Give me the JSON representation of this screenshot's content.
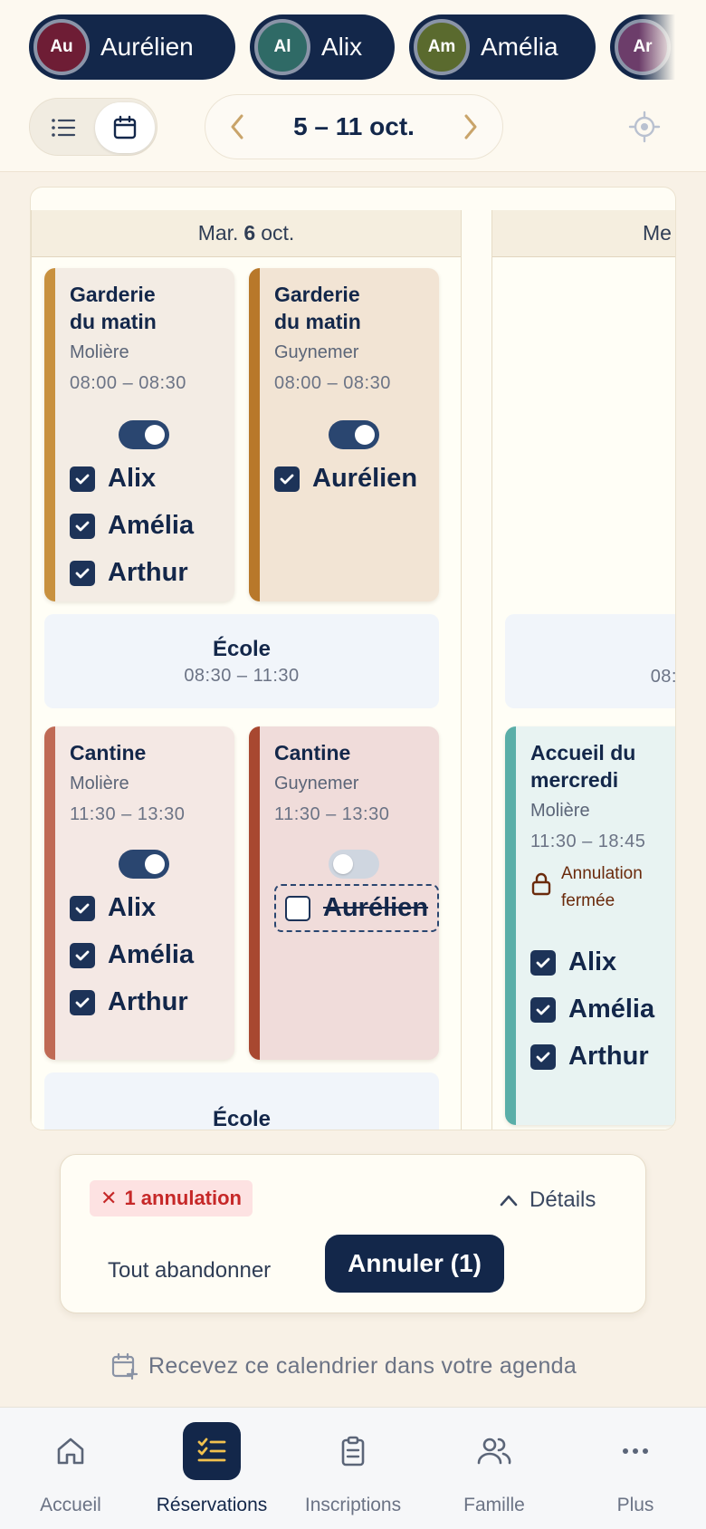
{
  "children": [
    {
      "initials": "Au",
      "name": "Aurélien",
      "color": "#6e1d35"
    },
    {
      "initials": "Al",
      "name": "Alix",
      "color": "#2f6a66"
    },
    {
      "initials": "Am",
      "name": "Amélia",
      "color": "#5a6a2e"
    },
    {
      "initials": "Ar",
      "name": "",
      "color": "#6c3d6a"
    }
  ],
  "week": {
    "label": "5 – 11 oct."
  },
  "days": [
    {
      "weekday": "Mar.",
      "daynum": "6",
      "month": "oct.",
      "morning": [
        {
          "title1": "Garderie",
          "title2": "du matin",
          "place": "Molière",
          "time": "08:00 – 08:30",
          "bar": "#c8913f",
          "bg": "#f3ece4",
          "kids": [
            "Alix",
            "Amélia",
            "Arthur"
          ]
        },
        {
          "title1": "Garderie",
          "title2": "du matin",
          "place": "Guynemer",
          "time": "08:00 – 08:30",
          "bar": "#b8782a",
          "bg": "#f2e4d4",
          "kids": [
            "Aurélien"
          ]
        }
      ],
      "school": {
        "label": "École",
        "time": "08:30 – 11:30"
      },
      "lunch": [
        {
          "title1": "Cantine",
          "place": "Molière",
          "time": "11:30 – 13:30",
          "bar": "#bf6a55",
          "bg": "#f4e8e4",
          "kids": [
            "Alix",
            "Amélia",
            "Arthur"
          ]
        },
        {
          "title1": "Cantine",
          "place": "Guynemer",
          "time": "11:30 – 13:30",
          "bar": "#a84830",
          "bg": "#f0dcda",
          "kids": [
            "Aurélien"
          ]
        }
      ],
      "school2": {
        "label": "École"
      }
    },
    {
      "weekday": "Me",
      "school": {
        "time": "08:"
      },
      "afternoon": {
        "title1": "Accueil du",
        "title2": "mercredi",
        "place": "Molière",
        "time": "11:30 – 18:45",
        "lock1": "Annulation",
        "lock2": "fermée",
        "bar": "#5aaea8",
        "bg": "#e8f3f2",
        "kids": [
          "Alix",
          "Amélia",
          "Arthur"
        ]
      }
    }
  ],
  "summary": {
    "badge_icon": "✕",
    "badge_text": "1 annulation",
    "details_label": "Détails",
    "abandon_label": "Tout abandonner",
    "confirm_label": "Annuler (1)"
  },
  "subscribe_label": "Recevez ce calendrier dans votre agenda",
  "tabs": [
    {
      "label": "Accueil",
      "icon": "home-icon"
    },
    {
      "label": "Réservations",
      "icon": "checklist-icon",
      "active": true
    },
    {
      "label": "Inscriptions",
      "icon": "clipboard-icon"
    },
    {
      "label": "Famille",
      "icon": "users-icon"
    },
    {
      "label": "Plus",
      "icon": "more-icon"
    }
  ]
}
